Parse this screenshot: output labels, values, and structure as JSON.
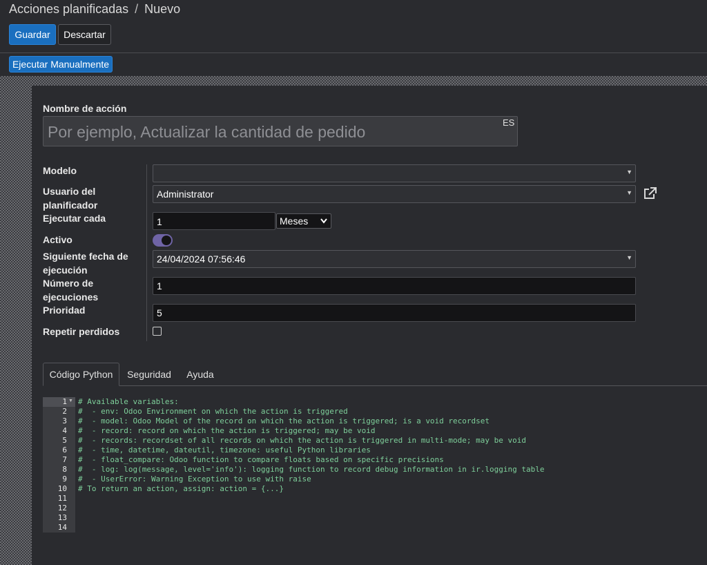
{
  "breadcrumb": {
    "parent": "Acciones planificadas",
    "separator": "/",
    "current": "Nuevo"
  },
  "toolbar": {
    "save_label": "Guardar",
    "discard_label": "Descartar",
    "run_manually_label": "Ejecutar Manualmente"
  },
  "form": {
    "name_label": "Nombre de acción",
    "name_placeholder": "Por ejemplo, Actualizar la cantidad de pedido",
    "lang_tag": "ES",
    "model_label": "Modelo",
    "model_value": "",
    "user_label_line1": "Usuario del",
    "user_label_line2": "planificador",
    "user_value": "Administrator",
    "interval_label": "Ejecutar cada",
    "interval_number": "1",
    "interval_unit": "Meses",
    "active_label": "Activo",
    "active": true,
    "nextcall_label_line1": "Siguiente fecha de",
    "nextcall_label_line2": "ejecución",
    "nextcall_value": "24/04/2024 07:56:46",
    "numcall_label_line1": "Número de",
    "numcall_label_line2": "ejecuciones",
    "numcall_value": "1",
    "priority_label": "Prioridad",
    "priority_value": "5",
    "doall_label": "Repetir perdidos",
    "doall": false
  },
  "tabs": [
    {
      "label": "Código Python",
      "active": true
    },
    {
      "label": "Seguridad",
      "active": false
    },
    {
      "label": "Ayuda",
      "active": false
    }
  ],
  "code": {
    "line_numbers": [
      "1",
      "2",
      "3",
      "4",
      "5",
      "6",
      "7",
      "8",
      "9",
      "10",
      "11",
      "12",
      "13",
      "14"
    ],
    "lines": [
      "# Available variables:",
      "#  - env: Odoo Environment on which the action is triggered",
      "#  - model: Odoo Model of the record on which the action is triggered; is a void recordset",
      "#  - record: record on which the action is triggered; may be void",
      "#  - records: recordset of all records on which the action is triggered in multi-mode; may be void",
      "#  - time, datetime, dateutil, timezone: useful Python libraries",
      "#  - float_compare: Odoo function to compare floats based on specific precisions",
      "#  - log: log(message, level='info'): logging function to record debug information in ir.logging table",
      "#  - UserError: Warning Exception to use with raise",
      "# To return an action, assign: action = {...}",
      "",
      "",
      "",
      ""
    ]
  },
  "colors": {
    "primary": "#1a6fbf",
    "toggle": "#6f64a6",
    "code_comment": "#7ecf9a"
  }
}
